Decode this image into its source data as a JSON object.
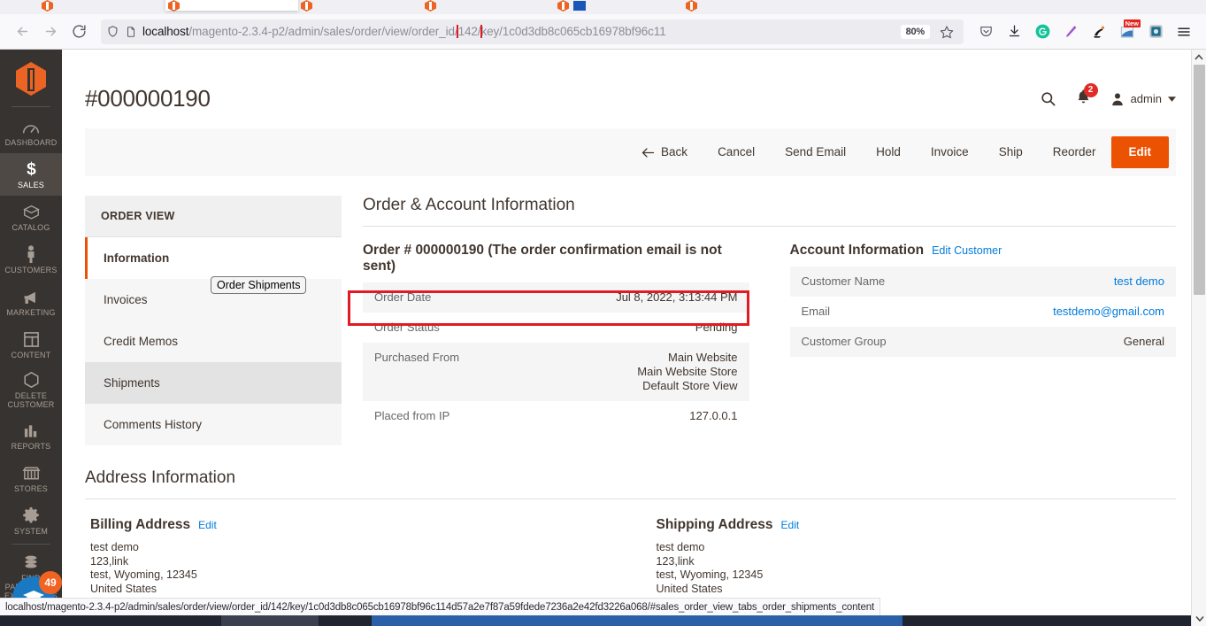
{
  "browser": {
    "url_prefix_host": "localhost",
    "url_rest_1": "/magento-2.3.4-p2/admin/sales/order/view/order_id/",
    "url_highlight": "142/",
    "url_rest_2": "key/1c0d3db8c065cb16978bf96c11",
    "zoom_level": "80%",
    "status_url": "localhost/magento-2.3.4-p2/admin/sales/order/view/order_id/142/key/1c0d3db8c065cb16978bf96c114d57a2e7f87a59fdede7236a2e42fd3226a068/#sales_order_view_tabs_order_shipments_content",
    "new_badge": "New",
    "icons": {
      "back": "back-arrow-icon",
      "forward": "forward-arrow-icon",
      "reload": "reload-icon",
      "shield": "shield-icon",
      "page": "page-icon",
      "star": "bookmark-star-icon",
      "pocket": "pocket-icon",
      "download": "download-icon",
      "grammarly": "grammarly-icon",
      "pen": "pen-extension-icon",
      "ink": "ink-extension-icon",
      "news": "news-extension-icon",
      "camera": "camera-extension-icon",
      "menu": "hamburger-menu-icon"
    }
  },
  "admin_nav": {
    "logo_name": "magento-logo",
    "items": [
      {
        "label": "DASHBOARD",
        "icon": "dashboard-icon",
        "active": false
      },
      {
        "label": "SALES",
        "icon": "dollar-icon",
        "active": true
      },
      {
        "label": "CATALOG",
        "icon": "box-icon",
        "active": false
      },
      {
        "label": "CUSTOMERS",
        "icon": "person-icon",
        "active": false
      },
      {
        "label": "MARKETING",
        "icon": "megaphone-icon",
        "active": false
      },
      {
        "label": "CONTENT",
        "icon": "layout-icon",
        "active": false
      },
      {
        "label": "DELETE CUSTOMER",
        "icon": "hexagon-icon",
        "active": false
      },
      {
        "label": "REPORTS",
        "icon": "bar-chart-icon",
        "active": false
      },
      {
        "label": "STORES",
        "icon": "store-icon",
        "active": false
      },
      {
        "label": "SYSTEM",
        "icon": "gear-icon",
        "active": false
      },
      {
        "label": "FIND PARTNERS & EXTENSIONS",
        "icon": "partners-icon",
        "active": false
      }
    ],
    "help_widget_count": "49"
  },
  "header": {
    "page_title": "#000000190",
    "search_icon": "search-icon",
    "notifications_count": "2",
    "user_label": "admin"
  },
  "actions": [
    {
      "label": "Back",
      "icon": "back-arrow-icon",
      "primary": false
    },
    {
      "label": "Cancel",
      "icon": null,
      "primary": false
    },
    {
      "label": "Send Email",
      "icon": null,
      "primary": false
    },
    {
      "label": "Hold",
      "icon": null,
      "primary": false
    },
    {
      "label": "Invoice",
      "icon": null,
      "primary": false
    },
    {
      "label": "Ship",
      "icon": null,
      "primary": false
    },
    {
      "label": "Reorder",
      "icon": null,
      "primary": false
    },
    {
      "label": "Edit",
      "icon": null,
      "primary": true
    }
  ],
  "order_view": {
    "heading": "ORDER VIEW",
    "items": [
      {
        "label": "Information",
        "state": "active"
      },
      {
        "label": "Invoices",
        "state": "normal"
      },
      {
        "label": "Credit Memos",
        "state": "normal"
      },
      {
        "label": "Shipments",
        "state": "hover"
      },
      {
        "label": "Comments History",
        "state": "normal"
      }
    ],
    "tooltip": "Order Shipments"
  },
  "order_account": {
    "section_title": "Order & Account Information",
    "order_heading": "Order # 000000190 (The order confirmation email is not sent)",
    "rows": [
      {
        "label": "Order Date",
        "value": "Jul 8, 2022, 3:13:44 PM",
        "alt": true,
        "highlighted": true
      },
      {
        "label": "Order Status",
        "value": "Pending",
        "alt": false,
        "highlighted": false
      },
      {
        "label": "Purchased From",
        "value": "Main Website\nMain Website Store\nDefault Store View",
        "alt": true,
        "highlighted": false
      },
      {
        "label": "Placed from IP",
        "value": "127.0.0.1",
        "alt": false,
        "highlighted": false
      }
    ],
    "account_title": "Account Information",
    "account_edit_link": "Edit Customer",
    "account_rows": [
      {
        "label": "Customer Name",
        "value": "test demo",
        "alt": true,
        "link": true
      },
      {
        "label": "Email",
        "value": "testdemo@gmail.com",
        "alt": false,
        "link": true
      },
      {
        "label": "Customer Group",
        "value": "General",
        "alt": true,
        "link": false
      }
    ]
  },
  "address": {
    "section_title": "Address Information",
    "billing": {
      "title": "Billing Address",
      "edit": "Edit",
      "lines": [
        "test demo",
        "123,link",
        "test, Wyoming, 12345",
        "United States"
      ]
    },
    "shipping": {
      "title": "Shipping Address",
      "edit": "Edit",
      "lines": [
        "test demo",
        "123,link",
        "test, Wyoming, 12345",
        "United States"
      ]
    }
  },
  "colors": {
    "accent_orange": "#eb5202",
    "link_blue": "#007bdb",
    "highlight_red": "#e01b24",
    "sidebar_bg": "#373330"
  }
}
